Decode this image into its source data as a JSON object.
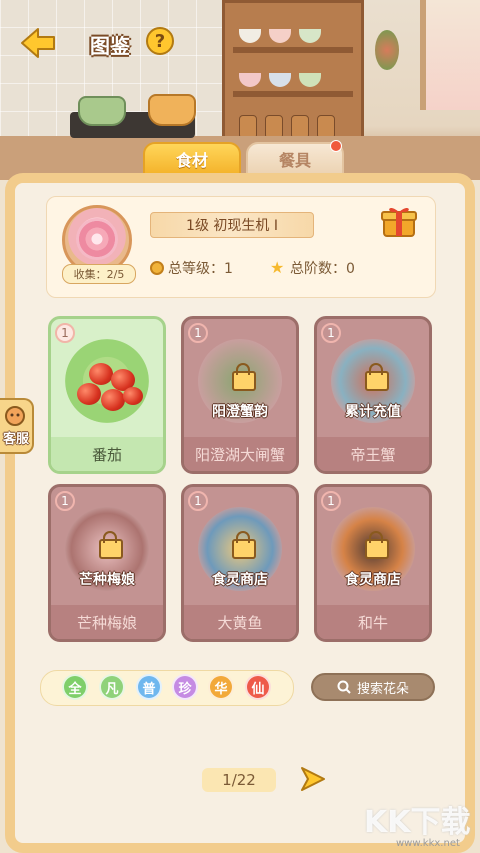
{
  "header": {
    "title": "图鉴",
    "help_label": "?"
  },
  "tabs": [
    {
      "label": "食材",
      "active": true
    },
    {
      "label": "餐具",
      "active": false,
      "has_notification": true
    }
  ],
  "summary": {
    "level_title": "1级   初现生机 I",
    "collect_label": "收集：2/5",
    "total_level_label": "总等级：1",
    "total_rank_label": "总阶数：0"
  },
  "cards": [
    {
      "name": "番茄",
      "count": "1",
      "locked": false,
      "overlay": ""
    },
    {
      "name": "阳澄湖大闸蟹",
      "count": "1",
      "locked": true,
      "overlay": "阳澄蟹韵"
    },
    {
      "name": "帝王蟹",
      "count": "1",
      "locked": true,
      "overlay": "累计充值"
    },
    {
      "name": "芒种梅娘",
      "count": "1",
      "locked": true,
      "overlay": "芒种梅娘"
    },
    {
      "name": "大黄鱼",
      "count": "1",
      "locked": true,
      "overlay": "食灵商店"
    },
    {
      "name": "和牛",
      "count": "1",
      "locked": true,
      "overlay": "食灵商店"
    }
  ],
  "filters": {
    "chips": [
      {
        "label": "全",
        "color": "#7fcf6a"
      },
      {
        "label": "凡",
        "color": "#8fd27a"
      },
      {
        "label": "普",
        "color": "#6fb7ee"
      },
      {
        "label": "珍",
        "color": "#c58be3"
      },
      {
        "label": "华",
        "color": "#f2a93a"
      },
      {
        "label": "仙",
        "color": "#ee5a4a"
      }
    ],
    "search_label": "搜索花朵"
  },
  "pagination": {
    "page_label": "1/22"
  },
  "side": {
    "service_label": "客服"
  },
  "watermark": {
    "text": "KK下载",
    "url": "www.kkx.net"
  },
  "colors": {
    "accent": "#f4b32b",
    "panel_border": "#f2cc8c",
    "locked_card": "#c39392",
    "unlocked_card": "#d8f0c9"
  }
}
